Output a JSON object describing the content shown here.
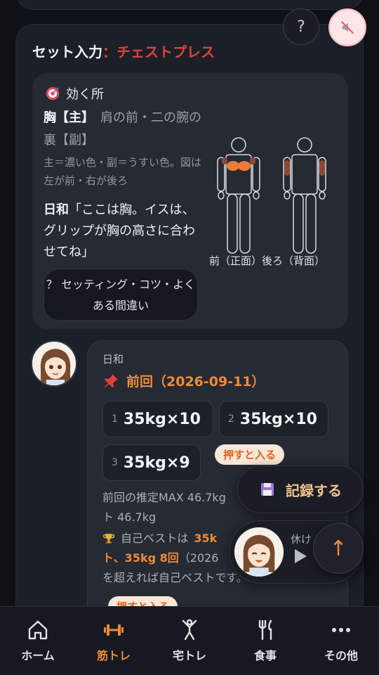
{
  "header": {
    "help_label": "?",
    "mute_icon": "speaker-muted-icon"
  },
  "set_input": {
    "title": "セット入力",
    "separator": "：",
    "exercise": "チェストプレス"
  },
  "effect": {
    "heading": "効く所",
    "main_muscle": "胸【主】",
    "sub_muscles": "肩の前・二の腕の裏【副】",
    "legend": "主＝濃い色・副＝うすい色。図は左が前・右が後ろ",
    "speaker": "日和",
    "quote": "「ここは胸。イスは、グリップが胸の高さに合わせてね」",
    "setting_button": "？ セッティング・コツ・よくある間違い",
    "figure_labels": "前（正面）後ろ（背面）"
  },
  "chat": {
    "name": "日和",
    "previous_heading": "前回（2026-09-11）",
    "sets": [
      {
        "num": "1",
        "value": "35kg×10"
      },
      {
        "num": "2",
        "value": "35kg×10"
      },
      {
        "num": "3",
        "value": "35kg×9"
      }
    ],
    "press_chip": "押すと入る",
    "estimate_text": "前回の推定MAX 46.7kg",
    "estimate_tail": "ト 46.7kg",
    "best_prefix": "自己ベストは",
    "best_value": "35k",
    "best_line2_hl": "ト、35kg 8回",
    "best_line2_rest": "（2026",
    "best_line3": "を超えれば自己ベストです。",
    "press_chip2": "押すと入る"
  },
  "floating": {
    "record_label": "記録する",
    "rest_label": "休け",
    "up_arrow": "↑"
  },
  "nav": [
    {
      "label": "ホーム",
      "icon": "home-icon"
    },
    {
      "label": "筋トレ",
      "icon": "dumbbell-icon"
    },
    {
      "label": "宅トレ",
      "icon": "stretch-person-icon"
    },
    {
      "label": "食事",
      "icon": "fork-knife-icon"
    },
    {
      "label": "その他",
      "icon": "more-dots-icon"
    }
  ],
  "colors": {
    "accent": "#f08a3a",
    "exercise_red": "#e2413b",
    "background": "#0e1116"
  }
}
